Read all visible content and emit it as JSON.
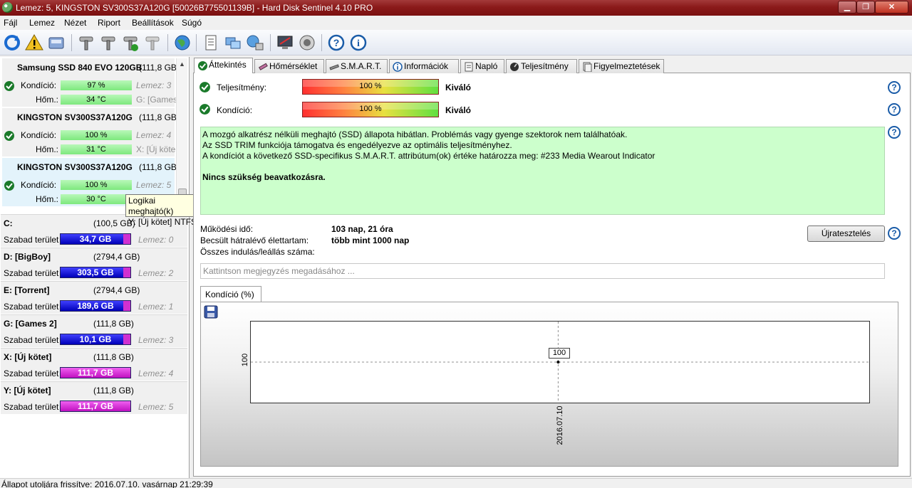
{
  "window": {
    "title": "Lemez: 5, KINGSTON SV300S37A120G [50026B775501139B]  -  Hard Disk Sentinel 4.10 PRO"
  },
  "menu": [
    "Fájl",
    "Lemez",
    "Nézet",
    "Riport",
    "Beállítások",
    "Súgó"
  ],
  "toolbar": {
    "icons": [
      "refresh-icon",
      "alert-icon",
      "disk-icon",
      "wrench-icon",
      "wrench-icon",
      "wrench-check-icon",
      "wrench-gray-icon",
      "globe-icon",
      "report-icon",
      "sync-icon",
      "network-icon",
      "pc-icon",
      "speaker-icon",
      "help-icon",
      "info-icon"
    ]
  },
  "disks": [
    {
      "name": "Samsung SSD 840 EVO 120GB",
      "size": "(111,8 GB)",
      "health_label": "Kondíció:",
      "health": "97 %",
      "temp_label": "Hőm.:",
      "temp": "34 °C",
      "disk_ref": "Lemez: 3",
      "vols": "G: [Games"
    },
    {
      "name": "KINGSTON SV300S37A120G",
      "size": "(111,8 GB)",
      "health_label": "Kondíció:",
      "health": "100 %",
      "temp_label": "Hőm.:",
      "temp": "31 °C",
      "disk_ref": "Lemez: 4",
      "vols": "X: [Új köte"
    },
    {
      "name": "KINGSTON SV300S37A120G",
      "size": "(111,8 GB)",
      "health_label": "Kondíció:",
      "health": "100 %",
      "temp_label": "Hőm.:",
      "temp": "30 °C",
      "disk_ref": "Lemez: 5",
      "vols": ""
    }
  ],
  "tooltip": {
    "line1": "Logikai meghajtó(k)",
    "line2": "Y: [Új kötet] NTFS"
  },
  "volumes": [
    {
      "name": "C:",
      "size": "(100,5 GB)",
      "free_label": "Szabad terület",
      "free": "34,7 GB",
      "disk": "Lemez: 0"
    },
    {
      "name": "D: [BigBoy]",
      "size": "(2794,4 GB)",
      "free_label": "Szabad terület",
      "free": "303,5 GB",
      "disk": "Lemez: 2"
    },
    {
      "name": "E: [Torrent]",
      "size": "(2794,4 GB)",
      "free_label": "Szabad terület",
      "free": "189,6 GB",
      "disk": "Lemez: 1"
    },
    {
      "name": "G: [Games 2]",
      "size": "(111,8 GB)",
      "free_label": "Szabad terület",
      "free": "10,1 GB",
      "disk": "Lemez: 3"
    },
    {
      "name": "X: [Új kötet]",
      "size": "(111,8 GB)",
      "free_label": "Szabad terület",
      "free": "111,7 GB",
      "disk": "Lemez: 4"
    },
    {
      "name": "Y: [Új kötet]",
      "size": "(111,8 GB)",
      "free_label": "Szabad terület",
      "free": "111,7 GB",
      "disk": "Lemez: 5"
    }
  ],
  "tabs": [
    "Áttekintés",
    "Hőmérséklet",
    "S.M.A.R.T.",
    "Információk",
    "Napló",
    "Teljesítmény",
    "Figyelmeztetések"
  ],
  "overview": {
    "performance_label": "Teljesítmény:",
    "performance_value": "100 %",
    "performance_status": "Kiváló",
    "health_label": "Kondíció:",
    "health_value": "100 %",
    "health_status": "Kiváló",
    "message_lines": [
      "A mozgó alkatrész nélküli meghajtó (SSD) állapota hibátlan. Problémás vagy gyenge szektorok nem találhatóak.",
      "Az SSD TRIM funkciója támogatva és engedélyezve az optimális teljesítményhez.",
      "A kondíciót a következő SSD-specifikus S.M.A.R.T. attribútum(ok) értéke határozza meg:  #233 Media Wearout Indicator"
    ],
    "message_bold": "Nincs szükség beavatkozásra.",
    "uptime_label": "Működési idő:",
    "uptime_value": "103 nap, 21 óra",
    "remaining_label": "Becsült hátralévő élettartam:",
    "remaining_value": "több mint 1000 nap",
    "startstop_label": "Összes indulás/leállás száma:",
    "retest_button": "Újratesztelés",
    "note_placeholder": "Kattintson megjegyzés megadásához ..."
  },
  "chart_tab": "Kondíció  (%)",
  "chart_data": {
    "type": "line",
    "x": [
      "2016.07.10"
    ],
    "y": [
      100
    ],
    "data_labels": [
      "100"
    ],
    "ytick_labels": [
      "100"
    ],
    "xtick_labels": [
      "2016.07.10"
    ]
  },
  "status_bar": "Állapot utoljára frissítve: 2016.07.10. vasárnap 21:29:39",
  "colors": {
    "title_bar": "#8b1a1a",
    "good_green": "#7ee87e",
    "message_bg": "#ccffcc",
    "free_blue": "#0000b8",
    "free_magenta": "#c010c0"
  }
}
